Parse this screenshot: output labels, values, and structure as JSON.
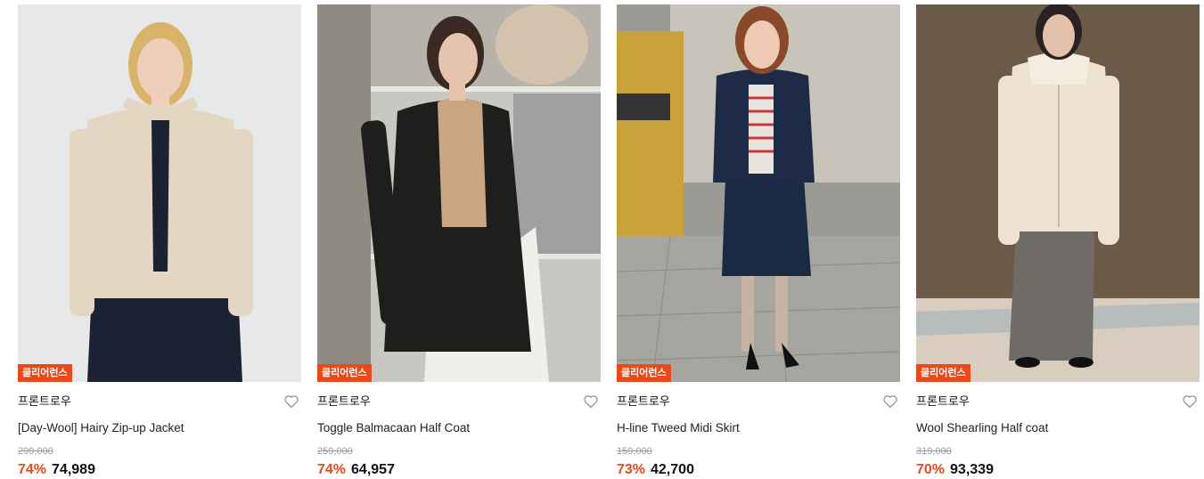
{
  "products": [
    {
      "badge": "클리어런스",
      "brand": "프론트로우",
      "name": "[Day-Wool] Hairy Zip-up Jacket",
      "original_price": "299,000",
      "discount": "74%",
      "price": "74,989",
      "image": "model-ivory-zip-jacket"
    },
    {
      "badge": "클리어런스",
      "brand": "프론트로우",
      "name": "Toggle Balmacaan Half Coat",
      "original_price": "259,000",
      "discount": "74%",
      "price": "64,957",
      "image": "model-black-toggle-coat"
    },
    {
      "badge": "클리어런스",
      "brand": "프론트로우",
      "name": "H-line Tweed Midi Skirt",
      "original_price": "159,000",
      "discount": "73%",
      "price": "42,700",
      "image": "model-navy-tweed-skirt"
    },
    {
      "badge": "클리어런스",
      "brand": "프론트로우",
      "name": "Wool Shearling Half coat",
      "original_price": "319,000",
      "discount": "70%",
      "price": "93,339",
      "image": "model-shearling-coat"
    }
  ],
  "colors": {
    "accent": "#e84a1c",
    "strike": "#9a9a9a",
    "text": "#111111"
  }
}
